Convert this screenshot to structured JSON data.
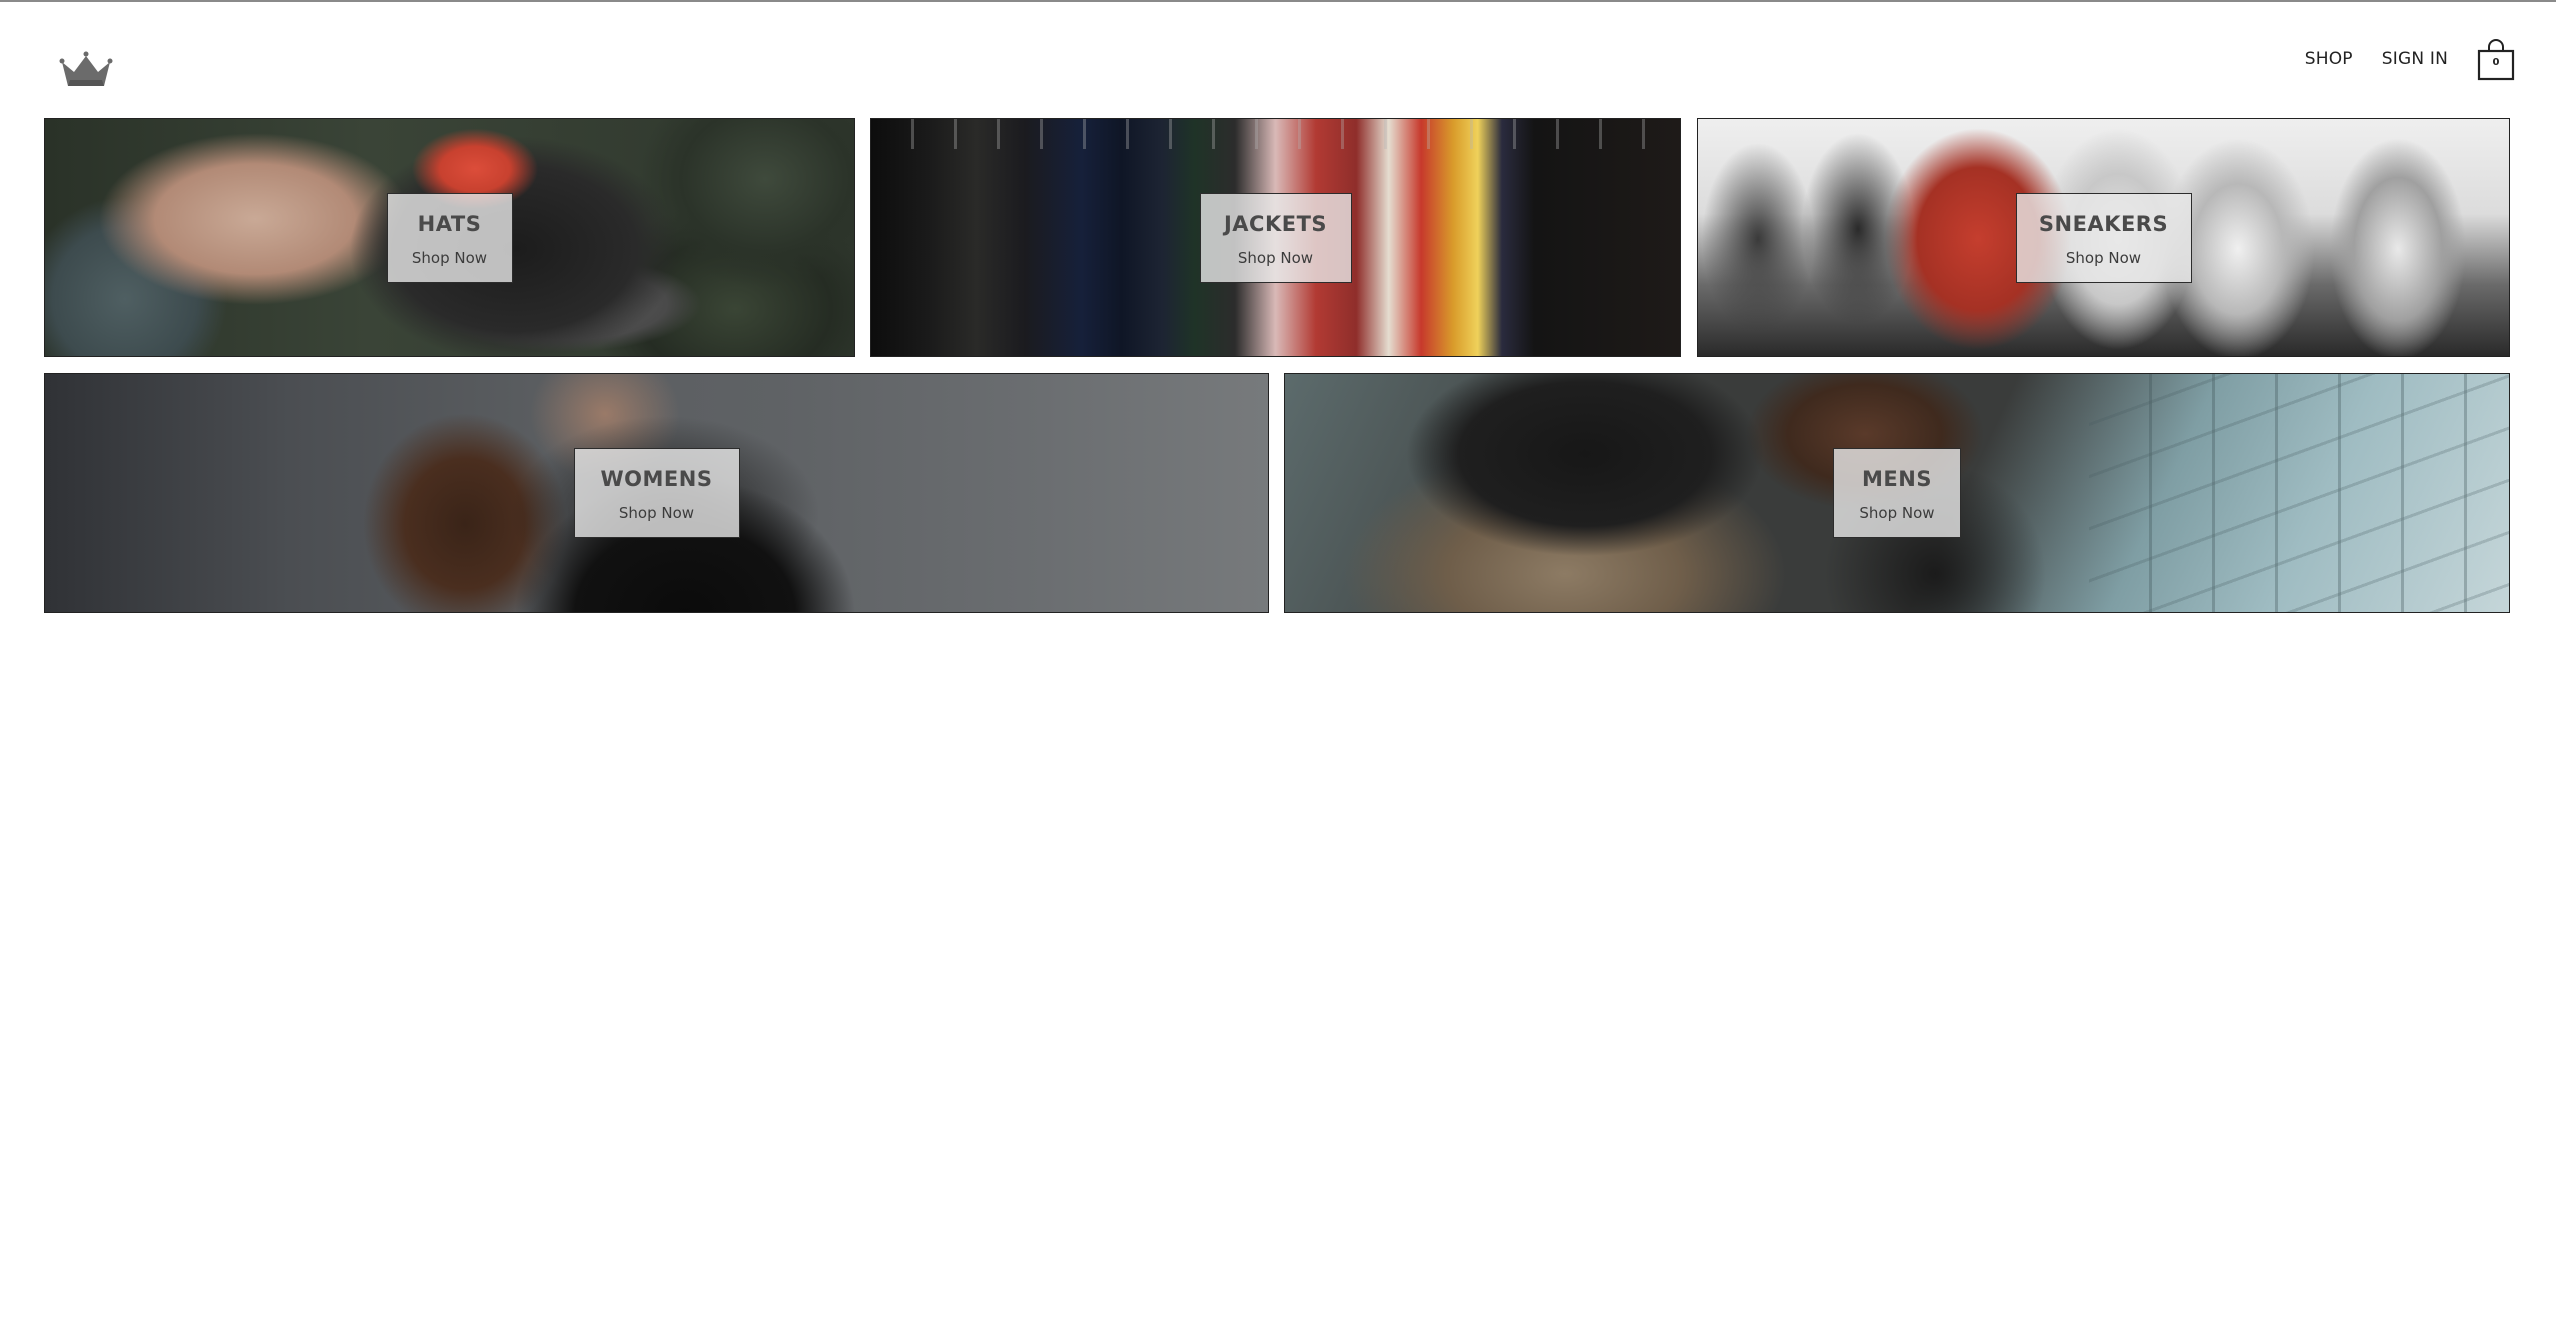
{
  "header": {
    "logo": {
      "icon": "crown-icon",
      "color": "#6b6b6b"
    },
    "nav": {
      "shop_label": "SHOP",
      "signin_label": "SIGN IN"
    },
    "cart": {
      "icon": "shopping-bag-icon",
      "count": "0"
    }
  },
  "directory": {
    "sections": [
      {
        "title": "HATS",
        "subtitle": "Shop Now"
      },
      {
        "title": "JACKETS",
        "subtitle": "Shop Now"
      },
      {
        "title": "SNEAKERS",
        "subtitle": "Shop Now"
      },
      {
        "title": "WOMENS",
        "subtitle": "Shop Now"
      },
      {
        "title": "MENS",
        "subtitle": "Shop Now"
      }
    ]
  }
}
